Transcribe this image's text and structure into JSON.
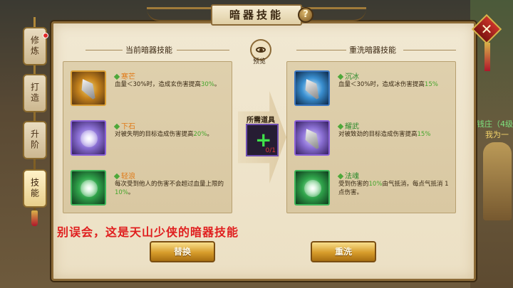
{
  "window": {
    "title": "暗器技能"
  },
  "tabs": [
    {
      "label": "修炼",
      "active": false,
      "badge": true
    },
    {
      "label": "打造",
      "active": false,
      "badge": false
    },
    {
      "label": "升阶",
      "active": false,
      "badge": false
    },
    {
      "label": "技能",
      "active": true,
      "badge": false
    }
  ],
  "sections": {
    "current": "当前暗器技能",
    "rewash": "重洗暗器技能",
    "preview": "预览"
  },
  "current_skills": [
    {
      "name": "寒芒",
      "icon": "dart-gold-icon",
      "name_color": "#e07a18",
      "desc_pre": "血量＜30%时，造成玄伤害提高",
      "desc_hl": "30%",
      "desc_post": "。"
    },
    {
      "name": "下石",
      "icon": "dart-purple-icon",
      "name_color": "#e07a18",
      "desc_pre": "对被失明的目标造成伤害提高",
      "desc_hl": "20%",
      "desc_post": "。"
    },
    {
      "name": "轻浪",
      "icon": "orb-green-icon",
      "name_color": "#e07a18",
      "desc_pre": "每次受到他人的伤害不会超过血量上限的",
      "desc_hl": "10%",
      "desc_post": "。"
    }
  ],
  "rewash_skills": [
    {
      "name": "沉冰",
      "icon": "dart-blue-icon",
      "name_color": "#2a8a2a",
      "desc_pre": "血量＜30%时，造成冰伤害提高",
      "desc_hl": "15%",
      "desc_post": ""
    },
    {
      "name": "耀武",
      "icon": "claw-purple-icon",
      "name_color": "#2a8a2a",
      "desc_pre": "对被致劲的目标造成伤害提高",
      "desc_hl": "15%",
      "desc_post": ""
    },
    {
      "name": "法魂",
      "icon": "orb-hand-green-icon",
      "name_color": "#2a8a2a",
      "desc_pre": "受到伤害的",
      "desc_hl": "10%",
      "desc_post": "由气抵消，每点气抵消 1 点伤害。"
    }
  ],
  "required": {
    "label": "所需道具",
    "count": "0/1"
  },
  "note": "别误会，这是天山少侠的暗器技能",
  "buttons": {
    "replace": "替换",
    "rewash": "重洗"
  },
  "scene": {
    "text1": "钱庄（4级",
    "text2": "我为一"
  },
  "colors": {
    "highlight": "#45a52c",
    "note": "#e01e1e",
    "button": "#d79c2a"
  }
}
